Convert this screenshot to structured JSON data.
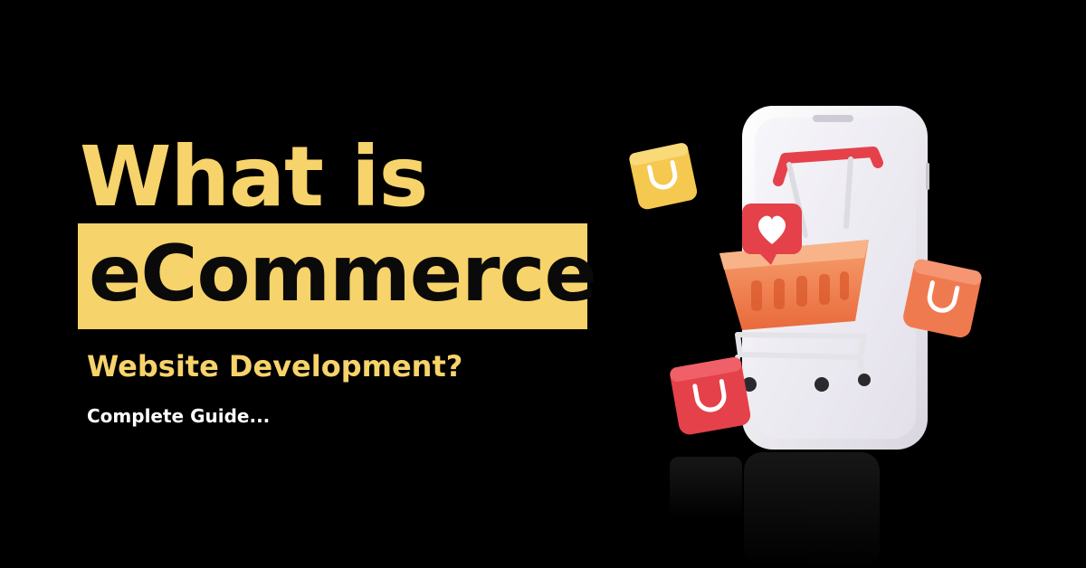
{
  "banner": {
    "headline_line1": "What is",
    "headline_highlight": "eCommerce",
    "subheadline": "Website Development?",
    "tagline": "Complete Guide..."
  },
  "colors": {
    "background": "#000000",
    "accent_yellow": "#f7d36b",
    "bag_red": "#e5414a",
    "bag_orange": "#f07a4f",
    "bag_yellow": "#f5c84f",
    "phone_white": "#f1eff4"
  },
  "illustration": {
    "icons": [
      "phone-icon",
      "shopping-cart-icon",
      "heart-icon",
      "shopping-bag-icon"
    ]
  }
}
